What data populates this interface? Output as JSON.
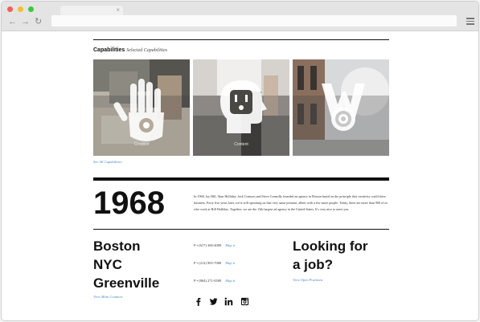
{
  "browser": {
    "colors": {
      "close": "#f25f58",
      "minimize": "#f9be2e",
      "maximize": "#3bc840"
    },
    "tab": {
      "close_glyph": "×"
    },
    "nav": {
      "back_glyph": "←",
      "forward_glyph": "→",
      "reload_glyph": "↻"
    },
    "icons": [
      "menu-icon"
    ]
  },
  "capabilities": {
    "title": "Capabilities",
    "subtitle": "Selected Capabilities",
    "cards": [
      {
        "label": "Creative",
        "icon": "hand-eye-icon"
      },
      {
        "label": "Content",
        "icon": "head-outlet-icon"
      },
      {
        "label": "",
        "icon": "w-target-icon"
      }
    ],
    "see_all": "See All Capabilities"
  },
  "about": {
    "year": "1968",
    "text": "In 1968, Jay Hill, Alan Holliday, Jack Connors and Steve Connolly founded an agency in Boston based on the principle that creativity could drive business. Forty five years later, we're still operating on that very same premise, albeit with a few more people. Today, there are more than 900 of us who work at Hill Holliday. Together, we are the 13th largest ad agency in the United States. It's very nice to meet you."
  },
  "offices": {
    "cities": [
      "Boston",
      "NYC",
      "Greenville"
    ],
    "view_contacts": "View Main Contacts",
    "phones": [
      {
        "number": "P • (617) 366-4000",
        "map_label": "Map it"
      },
      {
        "number": "P • (212) 905-7000",
        "map_label": "Map it"
      },
      {
        "number": "P • (864) 271-0500",
        "map_label": "Map it"
      }
    ],
    "social_icons": [
      "facebook-icon",
      "twitter-icon",
      "linkedin-icon",
      "instagram-icon"
    ]
  },
  "jobs": {
    "line1": "Looking for",
    "line2": "a job?",
    "link": "View Open Positions"
  }
}
